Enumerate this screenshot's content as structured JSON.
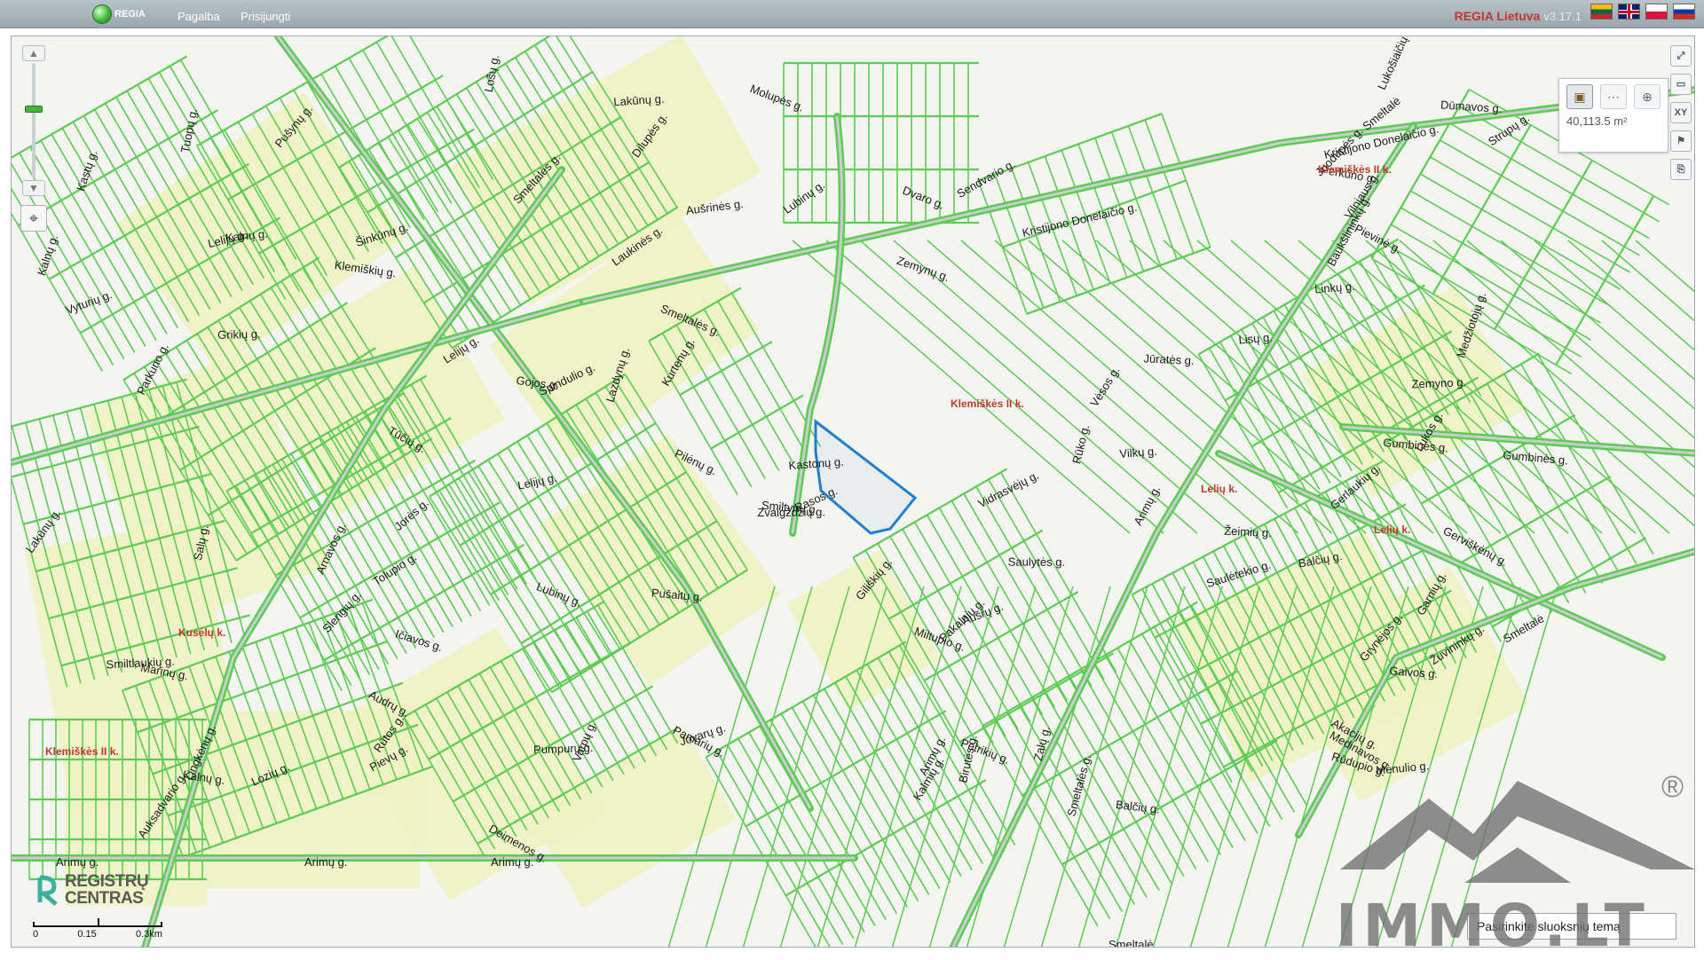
{
  "header": {
    "logo_text": "REGIA",
    "menu": [
      "Pagalba",
      "Prisijungti"
    ],
    "app_title": "REGIA Lietuva",
    "version": "v3.17.1",
    "flags": [
      "lithuanian-flag",
      "english-flag",
      "polish-flag",
      "russian-flag"
    ]
  },
  "map": {
    "parcel_color": "#5ccc52",
    "selection_color": "#1f7fd1",
    "residential_fill": "#eff2c3",
    "street_labels": [
      "Kristijono Donelaičio g.",
      "Kristijono Donelaičio g.",
      "Gumbinės g.",
      "Gumbinės g.",
      "Gerviškėnų g.",
      "Baukšlininkų g.",
      "Arimų g.",
      "Arimų g.",
      "Arimų g.",
      "Arimų g.",
      "Arimų g.",
      "Smeltalės g.",
      "Smeltalės g.",
      "Smeltalės g.",
      "Smeltalė",
      "Smeltalė",
      "Smeltalė",
      "Lubinų g.",
      "Lubinų g.",
      "Lelijų g.",
      "Lelijų g.",
      "Pievų g.",
      "Balčių g.",
      "Kastonų g.",
      "Zemyno g.",
      "Jorės g.",
      "Gojos g.",
      "Perkūno g.",
      "Parkuno g.",
      "Auksadvario g.",
      "Sendvario g.",
      "Dvaro g.",
      "Rūdupio g.",
      "Grynėjos g.",
      "Kalnų g.",
      "Lakūnų g.",
      "Vilkų g.",
      "Rūtos g.",
      "Varpų g.",
      "Molupės g.",
      "Birutės g.",
      "Pievinė g.",
      "Giliškių g.",
      "Šinkūnų g.",
      "Smiltlaukių g.",
      "Rūko g.",
      "Lingkėnų g.",
      "Zalų g.",
      "Medinavos g.",
      "Žuvininkų g.",
      "Ičiavos g.",
      "Laukinės g.",
      "Gerlaukių g.",
      "Pakalnių g.",
      "Vėsos g.",
      "Deimenos g.",
      "Petrikių g.",
      "Arnavos g.",
      "Smiltynų g.",
      "Lukos g.",
      "Aušrinės g.",
      "Rasos g.",
      "Jūratės g.",
      "Vyturių g.",
      "Slengių g.",
      "Tolupio g.",
      "Marinų g.",
      "Mėnulio g.",
      "Dūmavos g.",
      "Miltupio g.",
      "Kastų g.",
      "Tuopų g.",
      "Kalmių g.",
      "Kalnų g.",
      "Tūčių g.",
      "Pušaitų g.",
      "Lazdynų g.",
      "Audrų g.",
      "Lozių g.",
      "Lelijų g.",
      "Pušynų g.",
      "Vidrasvėjų g.",
      "Strupų g.",
      "Lošų g.",
      "Dilupės g.",
      "Gaivos g.",
      "Pamarių g.",
      "Saulėtekio g.",
      "Spindulio g.",
      "Zvaigždžių g.",
      "Saulytės g.",
      "Akacijų g.",
      "Pilėnų g.",
      "Medžiotojų g.",
      "Pumpurų g.",
      "Balčių g.",
      "Klemiškių g.",
      "Kalnų g.",
      "Aušrų g.",
      "Jovarų g.",
      "Linkų g.",
      "Kurtenų g.",
      "Zemynų g.",
      "Lisų g.",
      "Juodupės g.",
      "Lukošiaičių g.",
      "Lakūnų g.",
      "Vilniaus g.",
      "Garnių g.",
      "Salų g.",
      "Žeimių g.",
      "Grikių g."
    ],
    "area_labels": [
      "Klemiškės II k.",
      "Klemiškės II k.",
      "Lelių k.",
      "Lelių k.",
      "Kusėlų k.",
      "Klemiškės II k."
    ],
    "zoom_level": 0.6
  },
  "measure": {
    "tools": [
      "area-tool-icon",
      "distance-tool-icon",
      "point-tool-icon"
    ],
    "value": "40,113.5 m²"
  },
  "right_tools": [
    "fullscreen-icon",
    "print-icon",
    "coordinates-icon",
    "flag-icon",
    "link-icon"
  ],
  "right_tools_text": [
    "⤢",
    "▭",
    "XY",
    "⚑",
    "⎘"
  ],
  "branding": {
    "registry_name_line1": "REGISTRŲ",
    "registry_name_line2": "CENTRAS",
    "scale_labels": [
      "0",
      "0.15",
      "0.3km"
    ],
    "theme_select": "Pasirinkite sluoksnių temą",
    "watermark": "IMMO.LT",
    "watermark_mark": "®"
  }
}
